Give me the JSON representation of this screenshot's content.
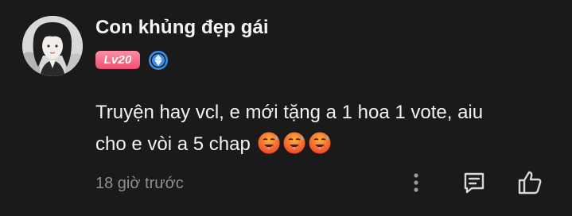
{
  "user": {
    "name": "Con khủng đẹp gái",
    "level": "Lv20",
    "avatar_icon": "user-avatar",
    "rank_icon": "diamond-rank-icon"
  },
  "comment": {
    "line1": "Truyện hay vcl, e mới tặng a 1 hoa 1 vote, aiu",
    "line2": "cho e vòi a 5 chap",
    "emojis": [
      "hot-face-emoji",
      "hot-face-emoji",
      "hot-face-emoji"
    ],
    "timestamp": "18 giờ trước"
  },
  "actions": {
    "more_icon": "more-vertical-icon",
    "reply_icon": "comment-reply-icon",
    "like_icon": "thumbs-up-icon"
  },
  "colors": {
    "background": "#1a1a1a",
    "text": "#f2f2f2",
    "muted": "#8f8f8f",
    "level_badge": "#f0506e",
    "rank_icon": "#3a8fe8"
  }
}
